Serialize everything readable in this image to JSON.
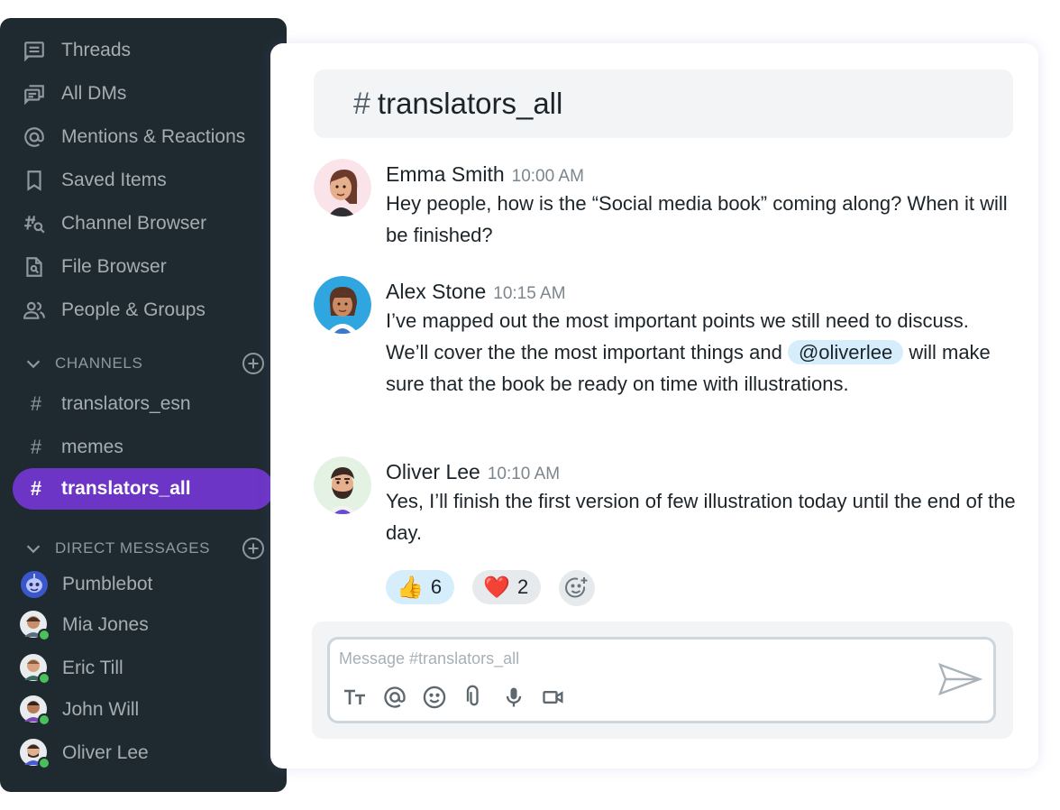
{
  "sidebar": {
    "nav": [
      {
        "label": "Threads",
        "icon": "threads-icon"
      },
      {
        "label": "All DMs",
        "icon": "dms-icon"
      },
      {
        "label": "Mentions & Reactions",
        "icon": "at-icon"
      },
      {
        "label": "Saved Items",
        "icon": "bookmark-icon"
      },
      {
        "label": "Channel Browser",
        "icon": "channel-search-icon"
      },
      {
        "label": "File Browser",
        "icon": "file-search-icon"
      },
      {
        "label": "People & Groups",
        "icon": "people-icon"
      }
    ],
    "channels_heading": "CHANNELS",
    "channels": [
      {
        "hash": "#",
        "name": "translators_esn"
      },
      {
        "hash": "#",
        "name": "memes"
      },
      {
        "hash": "#",
        "name": "translators_all",
        "active": true
      }
    ],
    "dm_heading": "DIRECT MESSAGES",
    "dms": [
      {
        "name": "Pumblebot"
      },
      {
        "name": "Mia Jones"
      },
      {
        "name": "Eric Till"
      },
      {
        "name": "John Will"
      },
      {
        "name": "Oliver Lee"
      }
    ]
  },
  "channel": {
    "hash": "#",
    "title": "translators_all"
  },
  "messages": [
    {
      "name": "Emma Smith",
      "time": "10:00 AM",
      "text": "Hey people, how is the “Social media book” coming along? When it will be finished?"
    },
    {
      "name": "Alex Stone",
      "time": "10:15 AM",
      "text_before": "I’ve mapped out the most important points we still need to discuss. We’ll cover the the most important things and",
      "mention": "@oliverlee",
      "text_after": "will make sure that the book be ready on time with illustrations."
    },
    {
      "name": "Oliver Lee",
      "time": "10:10 AM",
      "text": "Yes, I’ll finish the first version of few illustration today until the end of the day."
    }
  ],
  "reactions": [
    {
      "emoji": "👍",
      "count": "6"
    },
    {
      "emoji": "❤️",
      "count": "2"
    }
  ],
  "composer": {
    "placeholder": "Message #translators_all"
  },
  "colors": {
    "sidebar_bg": "#1f2a30",
    "accent": "#6d35c6",
    "mention_bg": "#d6eefb",
    "online": "#4bbf5a"
  }
}
